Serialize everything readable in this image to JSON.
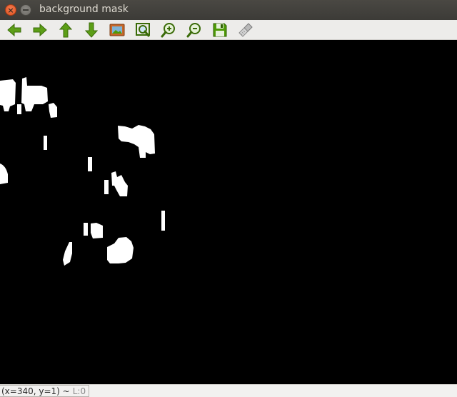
{
  "window": {
    "title": "background mask",
    "close_glyph": "×"
  },
  "toolbar": {
    "buttons": [
      {
        "name": "arrow-left-icon",
        "color": "#4e9a06"
      },
      {
        "name": "arrow-right-icon",
        "color": "#4e9a06"
      },
      {
        "name": "arrow-up-icon",
        "color": "#4e9a06"
      },
      {
        "name": "arrow-down-icon",
        "color": "#4e9a06"
      },
      {
        "name": "image-icon",
        "color": "#c8682a"
      },
      {
        "name": "zoom-fit-icon",
        "color": "#4e9a06"
      },
      {
        "name": "zoom-in-icon",
        "color": "#4e9a06"
      },
      {
        "name": "zoom-out-icon",
        "color": "#4e9a06"
      },
      {
        "name": "save-icon",
        "color": "#4e9a06"
      },
      {
        "name": "clear-brush-icon",
        "color": "#9a9a9a"
      }
    ]
  },
  "canvas": {
    "background": "#000000",
    "mask_color": "#ffffff"
  },
  "statusbar": {
    "coordinates": "(x=340, y=1) ~",
    "level": "L:0"
  }
}
